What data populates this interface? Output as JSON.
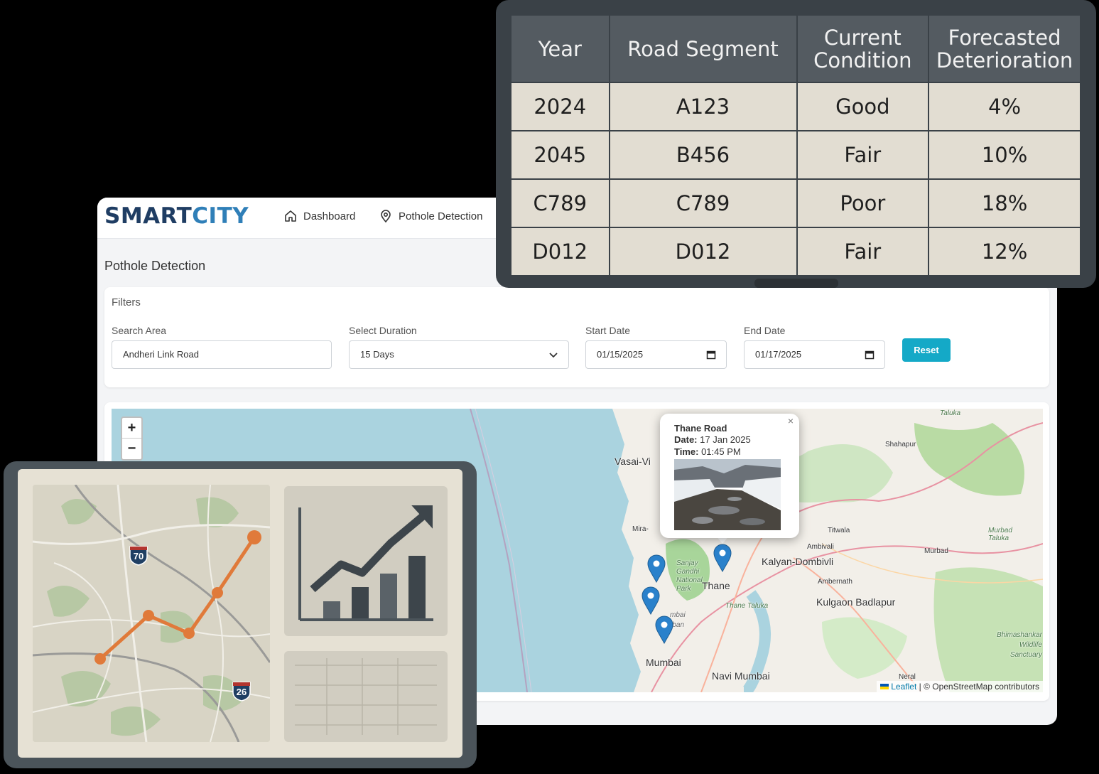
{
  "app": {
    "logo_part1": "SMART",
    "logo_part2": "CITY",
    "nav": [
      {
        "label": "Dashboard",
        "icon": "home-icon"
      },
      {
        "label": "Pothole Detection",
        "icon": "location-pin-icon"
      }
    ],
    "page_title": "Pothole Detection"
  },
  "filters": {
    "title": "Filters",
    "search_area_label": "Search Area",
    "search_area_value": "Andheri Link Road",
    "duration_label": "Select Duration",
    "duration_value": "15 Days",
    "start_date_label": "Start Date",
    "start_date_value": "01/15/2025",
    "end_date_label": "End Date",
    "end_date_value": "01/17/2025",
    "reset_label": "Reset",
    "accent": "#14a9c7"
  },
  "map": {
    "zoom_in": "+",
    "zoom_out": "−",
    "popup": {
      "close": "×",
      "title": "Thane Road",
      "date_label": "Date:",
      "date_value": "17 Jan 2025",
      "time_label": "Time:",
      "time_value": "01:45 PM"
    },
    "attribution_link": "Leaflet",
    "attribution_text": "| © OpenStreetMap contributors",
    "places": {
      "vasai": "Vasai-Vi",
      "mira": "Mira-",
      "sanjay": "Sanjay Gandhi National Park",
      "thane": "Thane",
      "thane_taluka": "Thane Taluka",
      "kalyan": "Kalyan-Dombivli",
      "ambivali": "Ambivali",
      "titwala": "Titwala",
      "shahapur": "Shahapur",
      "taluka": "Taluka",
      "murbad": "Murbad",
      "murbad_taluka": "Murbad Taluka",
      "ambernath": "Ambernath",
      "kulgaon": "Kulgaon Badlapur",
      "bhimashankar": "Bhimashankar Wildlife Sanctuary",
      "mumbai": "Mumbai",
      "mumbai_suburban": "mbai rban",
      "navi_mumbai": "Navi Mumbai",
      "neral": "Neral"
    },
    "marker_color": "#2a81cb"
  },
  "forecast_table": {
    "headers": [
      "Year",
      "Road Segment",
      "Current Condition",
      "Forecasted Deterioration"
    ],
    "rows": [
      [
        "2024",
        "A123",
        "Good",
        "4%"
      ],
      [
        "2045",
        "B456",
        "Fair",
        "10%"
      ],
      [
        "C789",
        "C789",
        "Poor",
        "18%"
      ],
      [
        "D012",
        "D012",
        "Fair",
        "12%"
      ]
    ]
  },
  "illustration": {
    "highway_1": "70",
    "highway_2": "26",
    "line_color": "#e07a3a"
  }
}
